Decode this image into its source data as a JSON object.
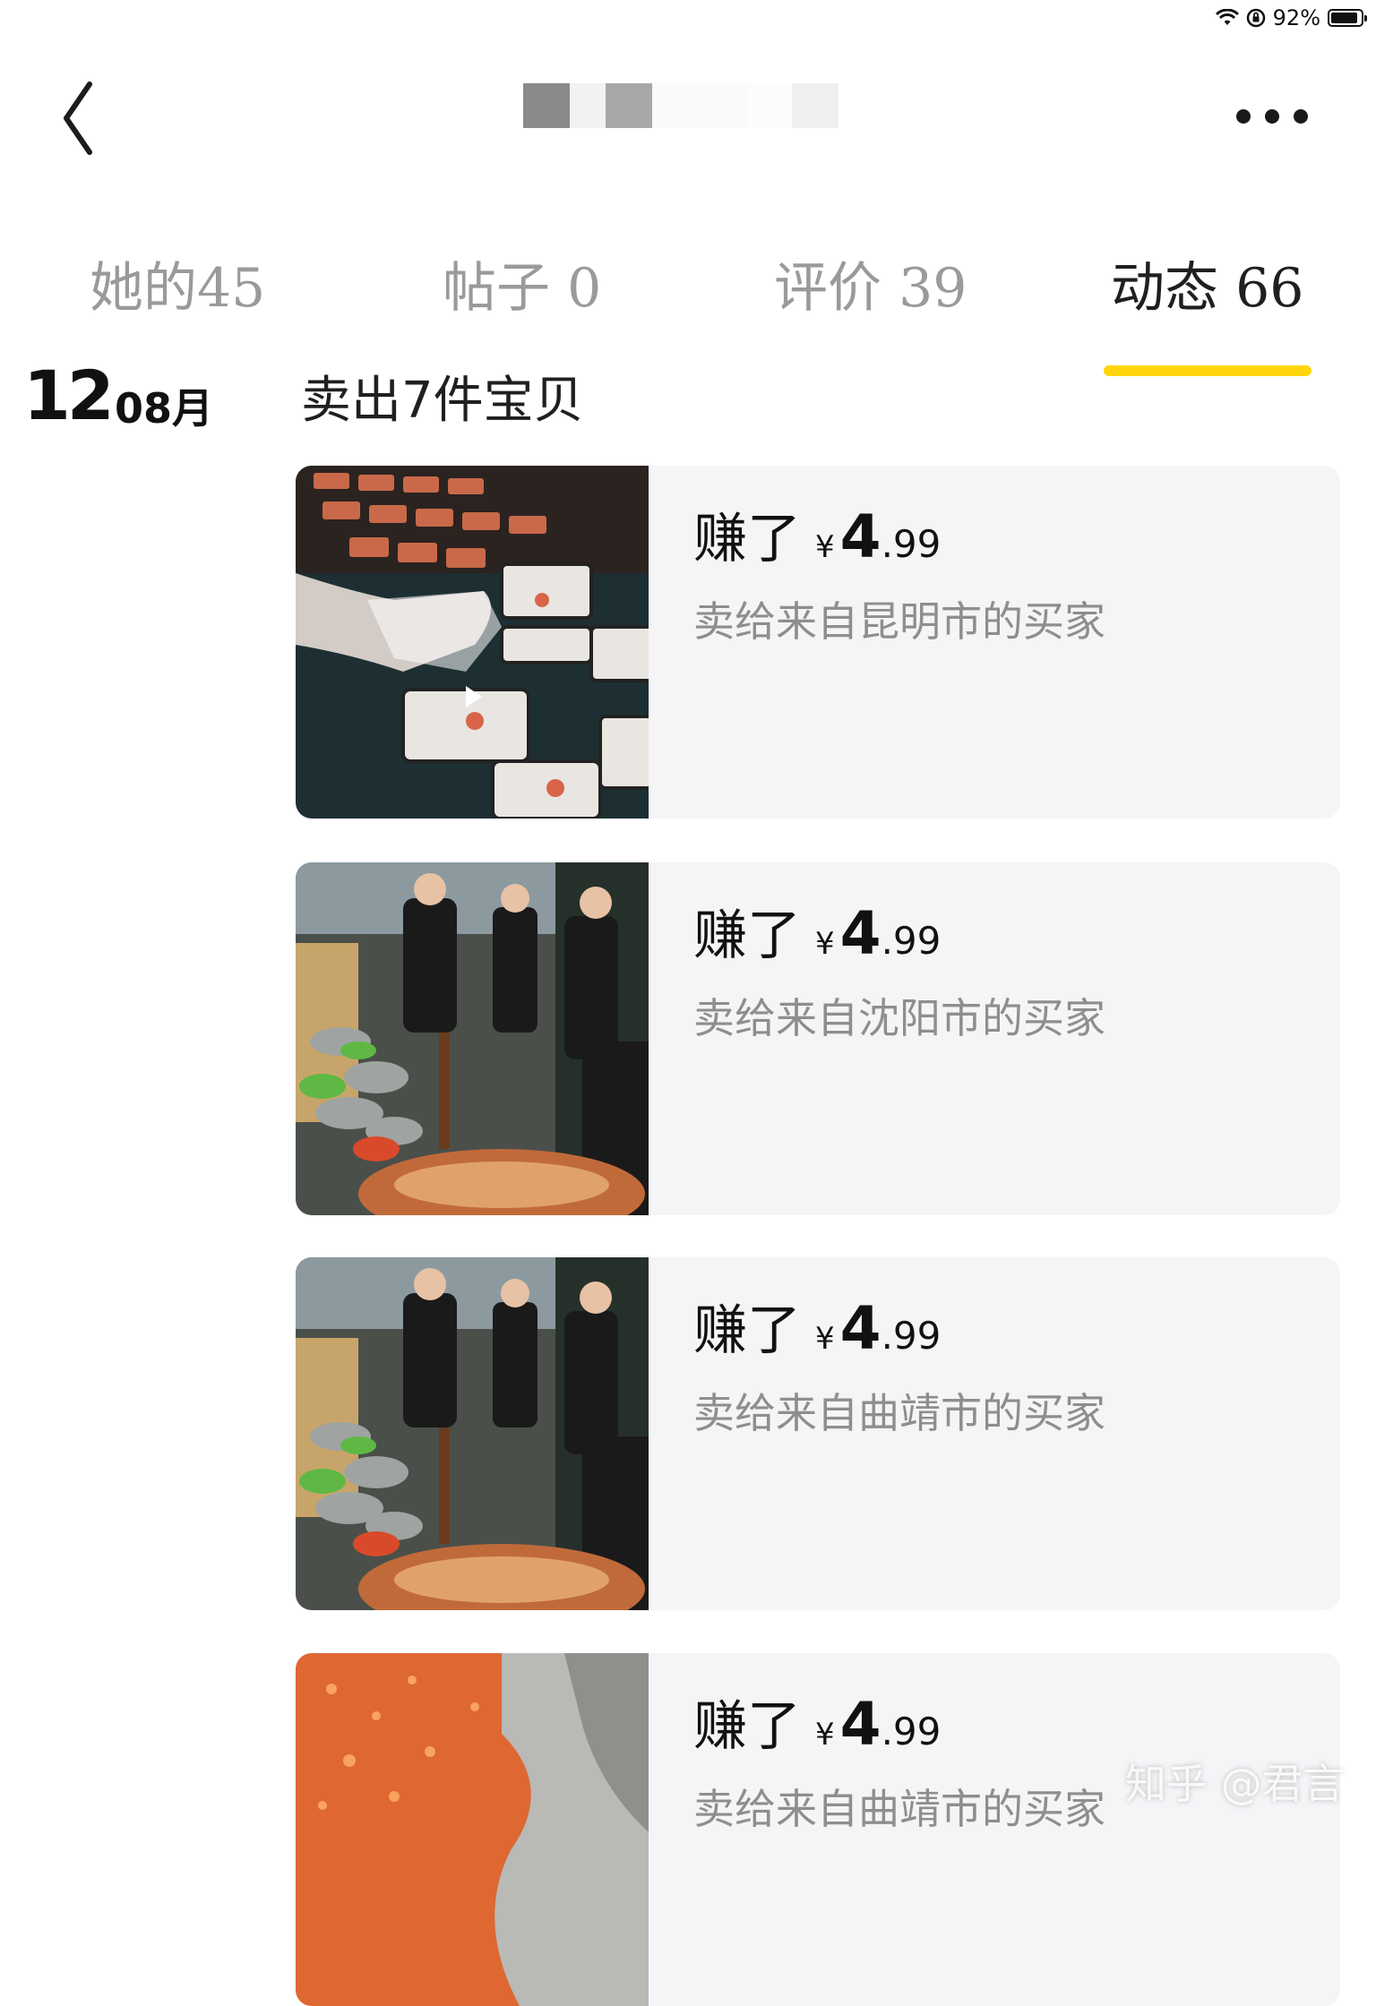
{
  "status_bar": {
    "battery_text": "92%",
    "battery_level": 0.92
  },
  "header": {
    "title": ""
  },
  "tabs": [
    {
      "label": "她的45"
    },
    {
      "label": "帖子 0"
    },
    {
      "label": "评价 39"
    },
    {
      "label": "动态 66",
      "active": true
    }
  ],
  "feed": {
    "date_day": "12",
    "date_month": "08月",
    "section_title": "卖出7件宝贝",
    "items": [
      {
        "earn_label": "赚了",
        "currency": "¥",
        "amount_int": "4",
        "amount_dec": ".99",
        "buyer": "卖给来自昆明市的买家"
      },
      {
        "earn_label": "赚了",
        "currency": "¥",
        "amount_int": "4",
        "amount_dec": ".99",
        "buyer": "卖给来自沈阳市的买家"
      },
      {
        "earn_label": "赚了",
        "currency": "¥",
        "amount_int": "4",
        "amount_dec": ".99",
        "buyer": "卖给来自曲靖市的买家"
      },
      {
        "earn_label": "赚了",
        "currency": "¥",
        "amount_int": "4",
        "amount_dec": ".99",
        "buyer": "卖给来自曲靖市的买家"
      }
    ]
  },
  "watermark": "知乎 @君言",
  "colors": {
    "accent": "#ffd60a",
    "card_bg": "#f5f5f8",
    "muted": "#8e8e8e"
  },
  "icons": [
    "wifi-icon",
    "rotation-lock-icon",
    "battery-icon",
    "back-chevron-icon",
    "more-dots-icon",
    "play-icon"
  ]
}
